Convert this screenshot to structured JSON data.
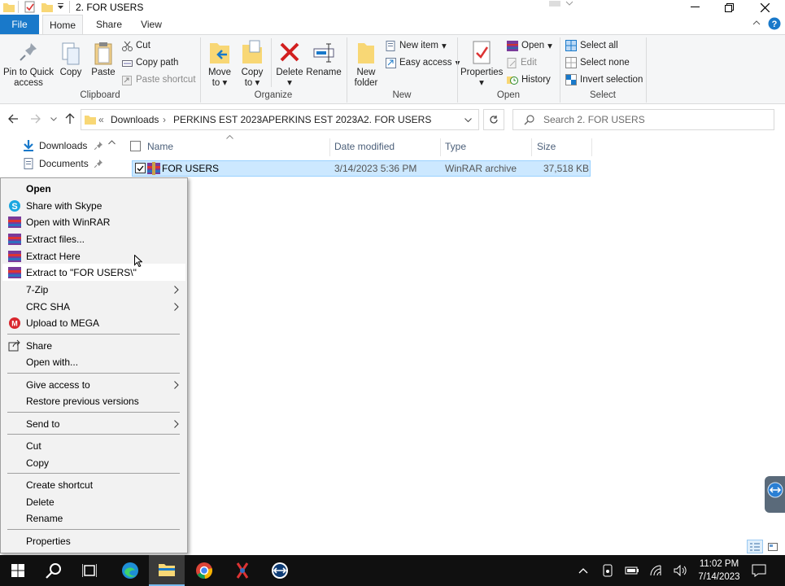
{
  "window": {
    "title": "2. FOR USERS"
  },
  "tabs": [
    "File",
    "Home",
    "Share",
    "View"
  ],
  "ribbon": {
    "clipboard": {
      "pin": "Pin to Quick access",
      "pin_l1": "Pin to Quick",
      "pin_l2": "access",
      "copy": "Copy",
      "paste": "Paste",
      "cut": "Cut",
      "copy_path": "Copy path",
      "paste_shortcut": "Paste shortcut",
      "label": "Clipboard"
    },
    "organize": {
      "move_l1": "Move",
      "move_l2": "to",
      "copy_l1": "Copy",
      "copy_l2": "to",
      "delete": "Delete",
      "rename": "Rename",
      "label": "Organize"
    },
    "new": {
      "folder_l1": "New",
      "folder_l2": "folder",
      "new_item": "New item",
      "easy_access": "Easy access",
      "label": "New"
    },
    "open": {
      "properties": "Properties",
      "open": "Open",
      "edit": "Edit",
      "history": "History",
      "label": "Open"
    },
    "select": {
      "select_all": "Select all",
      "select_none": "Select none",
      "invert": "Invert selection",
      "label": "Select"
    }
  },
  "address": {
    "crumbs": [
      "Downloads",
      "PERKINS EST 2023A",
      "PERKINS EST 2023A",
      "2. FOR USERS"
    ],
    "overflow": "«",
    "search_placeholder": "Search 2. FOR USERS"
  },
  "nav": {
    "items": [
      "Downloads",
      "Documents"
    ]
  },
  "columns": [
    "Name",
    "Date modified",
    "Type",
    "Size"
  ],
  "files": [
    {
      "name": "FOR USERS",
      "date": "3/14/2023 5:36 PM",
      "type": "WinRAR archive",
      "size": "37,518 KB",
      "selected": true
    }
  ],
  "context_menu": {
    "open": "Open",
    "share_skype": "Share with Skype",
    "open_winrar": "Open with WinRAR",
    "extract_files": "Extract files...",
    "extract_here": "Extract Here",
    "extract_to": "Extract to \"FOR USERS\\\"",
    "sevenzip": "7-Zip",
    "crc_sha": "CRC SHA",
    "upload_mega": "Upload to MEGA",
    "share": "Share",
    "open_with": "Open with...",
    "give_access": "Give access to",
    "restore": "Restore previous versions",
    "send_to": "Send to",
    "cut": "Cut",
    "copy": "Copy",
    "create_shortcut": "Create shortcut",
    "delete": "Delete",
    "rename": "Rename",
    "properties": "Properties"
  },
  "taskbar": {
    "time": "11:02 PM",
    "date": "7/14/2023"
  },
  "colors": {
    "accent": "#1979ca",
    "selection": "#cce8ff",
    "taskbar": "#101010",
    "ribbon": "#f5f6f7"
  }
}
